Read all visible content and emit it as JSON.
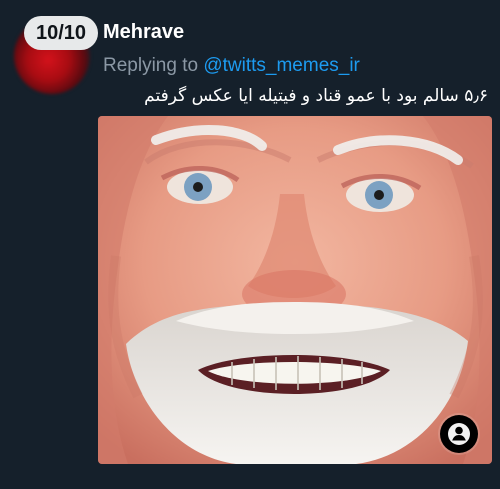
{
  "overlay": {
    "counter": "10/10"
  },
  "post": {
    "display_name": "Mehrave",
    "reply_prefix": "Replying to",
    "reply_handle": "@twitts_memes_ir",
    "text": "۵٫۶ سالم بود با عمو قناد و فیتیله ایا عکس گرفتم"
  },
  "media": {
    "subject_icon": "meme-face-photo",
    "button_icon": "person-icon"
  }
}
